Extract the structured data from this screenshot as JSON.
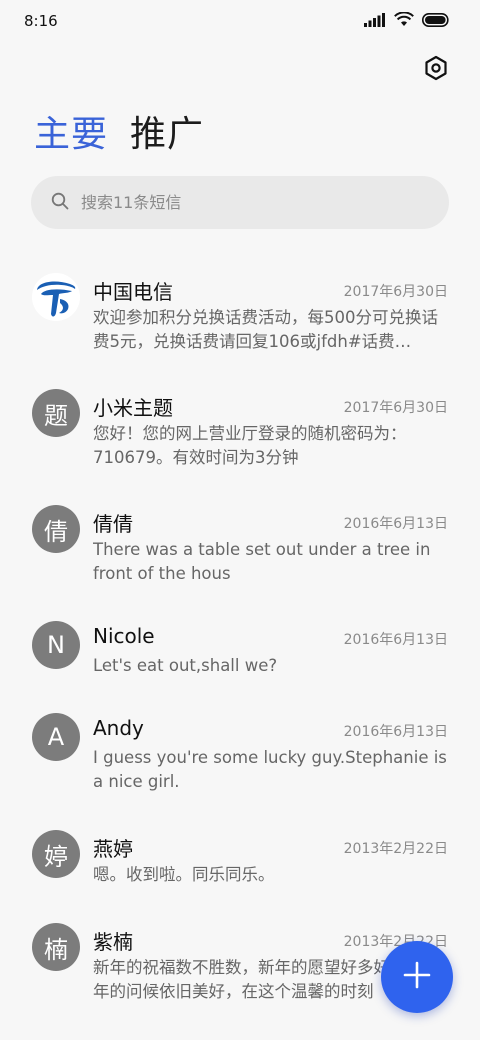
{
  "status_bar": {
    "time": "8:16",
    "icons": [
      "signal-icon",
      "wifi-icon",
      "battery-icon"
    ]
  },
  "header": {
    "settings_icon": "settings-hexagon-icon"
  },
  "tabs": [
    {
      "label": "主要",
      "active": true
    },
    {
      "label": "推广",
      "active": false
    }
  ],
  "search": {
    "placeholder": "搜索11条短信",
    "icon": "search-icon"
  },
  "messages": [
    {
      "avatar": "",
      "avatar_icon": "china-telecom-logo",
      "sender": "中国电信",
      "date": "2017年6月30日",
      "preview": "欢迎参加积分兑换话费活动，每500分可兑换话费5元，兑换话费请回复106或jfdh#话费…"
    },
    {
      "avatar": "题",
      "sender": "小米主题",
      "date": "2017年6月30日",
      "preview": "您好！您的网上营业厅登录的随机密码为：710679。有效时间为3分钟"
    },
    {
      "avatar": "倩",
      "sender": "倩倩",
      "date": "2016年6月13日",
      "preview": "There was a table set out under a tree in front of the hous"
    },
    {
      "avatar": "N",
      "sender": "Nicole",
      "date": "2016年6月13日",
      "preview": "Let's eat out,shall we?"
    },
    {
      "avatar": "A",
      "sender": "Andy",
      "date": "2016年6月13日",
      "preview": "I guess you're some lucky guy.Stephanie is a nice girl."
    },
    {
      "avatar": "婷",
      "sender": "燕婷",
      "date": "2013年2月22日",
      "preview": "嗯。收到啦。同乐同乐。"
    },
    {
      "avatar": "楠",
      "sender": "紫楠",
      "date": "2013年2月22日",
      "preview": "新年的祝福数不胜数，新年的愿望好多好多，新年的问候依旧美好，在这个温馨的时刻"
    }
  ],
  "fab": {
    "icon": "plus-icon"
  },
  "colors": {
    "accent": "#3a63d8",
    "fab": "#2f63ee",
    "avatar_gray": "#7c7c7c",
    "telecom_blue": "#1a5fb4"
  }
}
